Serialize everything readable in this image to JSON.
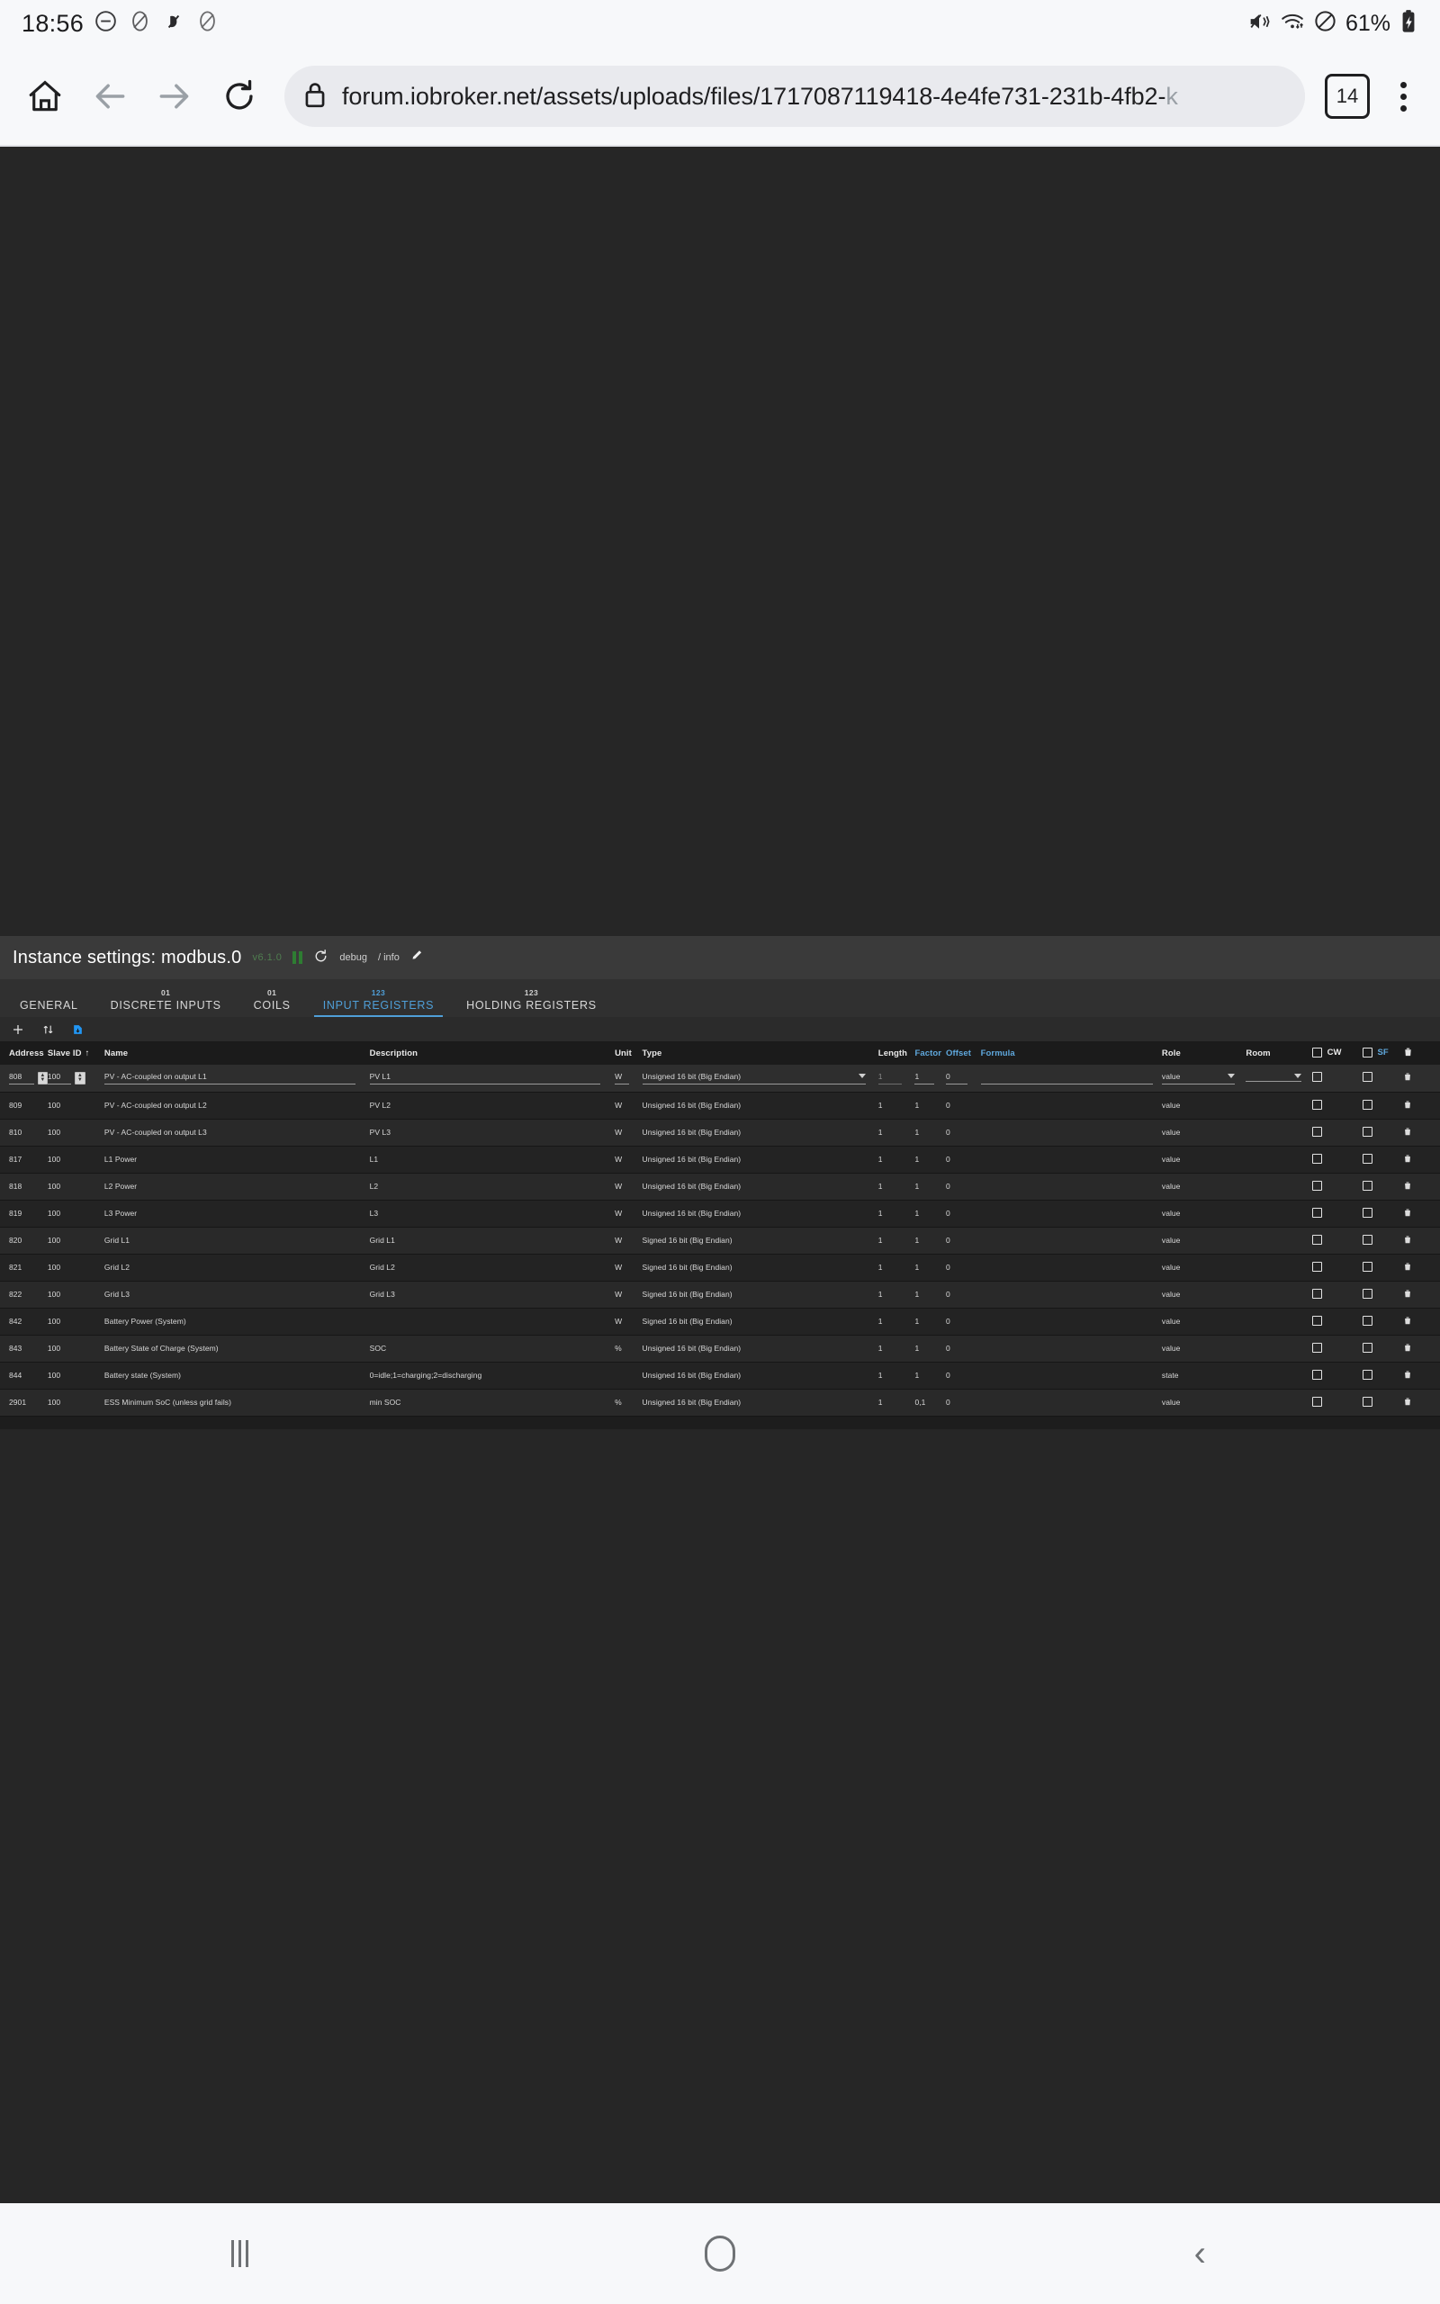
{
  "status_bar": {
    "clock": "18:56",
    "icons_left": [
      "do-not-disturb-icon",
      "no-notification-icon",
      "vibrate-off-icon",
      "no-notification-icon-2"
    ],
    "icons_right": [
      "mute-vibrate-icon",
      "wifi-icon",
      "block-icon"
    ],
    "battery_percent": "61%",
    "battery_icon": "battery-charging-icon"
  },
  "browser": {
    "home_icon": "home-icon",
    "back_icon": "back-arrow-icon",
    "forward_icon": "forward-arrow-icon",
    "reload_icon": "reload-icon",
    "lock_icon": "lock-icon",
    "url_visible": "forum.iobroker.net/assets/uploads/files/1717087119418-4e4fe731-231b-4fb2-",
    "url_faded": "k",
    "tab_count": "14",
    "menu_icon": "kebab-menu-icon"
  },
  "app": {
    "title": "Instance settings: modbus.0",
    "version": "v6.1.0",
    "pause_icon": "pause-icon",
    "refresh_icon": "refresh-icon",
    "log_level": "debug",
    "log_level_sep": "/ info",
    "edit_icon": "pencil-icon",
    "tabs": [
      {
        "badge": "",
        "label": "GENERAL",
        "active": false
      },
      {
        "badge": "01",
        "label": "DISCRETE INPUTS",
        "active": false
      },
      {
        "badge": "01",
        "label": "COILS",
        "active": false
      },
      {
        "badge": "123",
        "label": "INPUT REGISTERS",
        "active": true
      },
      {
        "badge": "123",
        "label": "HOLDING REGISTERS",
        "active": false
      }
    ],
    "toolbar": {
      "add_icon": "plus-icon",
      "sort_icon": "sort-updown-icon",
      "import_icon": "import-export-icon"
    },
    "table": {
      "columns": [
        {
          "key": "address",
          "label": "Address",
          "blue": false
        },
        {
          "key": "slave",
          "label": "Slave ID",
          "blue": false,
          "sort": "↑"
        },
        {
          "key": "name",
          "label": "Name",
          "blue": false
        },
        {
          "key": "desc",
          "label": "Description",
          "blue": false
        },
        {
          "key": "unit",
          "label": "Unit",
          "blue": false
        },
        {
          "key": "type",
          "label": "Type",
          "blue": false
        },
        {
          "key": "length",
          "label": "Length",
          "blue": false
        },
        {
          "key": "factor",
          "label": "Factor",
          "blue": true
        },
        {
          "key": "offset",
          "label": "Offset",
          "blue": true
        },
        {
          "key": "formula",
          "label": "Formula",
          "blue": true
        },
        {
          "key": "role",
          "label": "Role",
          "blue": false
        },
        {
          "key": "room",
          "label": "Room",
          "blue": false
        },
        {
          "key": "cw",
          "label": "CW",
          "blue": false
        },
        {
          "key": "sf",
          "label": "SF",
          "blue": true
        },
        {
          "key": "delete",
          "label": "",
          "blue": false
        }
      ],
      "rows": [
        {
          "address": "808",
          "slave": "100",
          "name": "PV - AC-coupled on output L1",
          "desc": "PV L1",
          "unit": "W",
          "type": "Unsigned 16 bit (Big Endian)",
          "length": "1",
          "factor": "1",
          "offset": "0",
          "formula": "",
          "role": "value",
          "room": ""
        },
        {
          "address": "809",
          "slave": "100",
          "name": "PV - AC-coupled on output L2",
          "desc": "PV L2",
          "unit": "W",
          "type": "Unsigned 16 bit (Big Endian)",
          "length": "1",
          "factor": "1",
          "offset": "0",
          "formula": "",
          "role": "value",
          "room": ""
        },
        {
          "address": "810",
          "slave": "100",
          "name": "PV - AC-coupled on output L3",
          "desc": "PV L3",
          "unit": "W",
          "type": "Unsigned 16 bit (Big Endian)",
          "length": "1",
          "factor": "1",
          "offset": "0",
          "formula": "",
          "role": "value",
          "room": ""
        },
        {
          "address": "817",
          "slave": "100",
          "name": "L1 Power",
          "desc": "L1",
          "unit": "W",
          "type": "Unsigned 16 bit (Big Endian)",
          "length": "1",
          "factor": "1",
          "offset": "0",
          "formula": "",
          "role": "value",
          "room": ""
        },
        {
          "address": "818",
          "slave": "100",
          "name": "L2 Power",
          "desc": "L2",
          "unit": "W",
          "type": "Unsigned 16 bit (Big Endian)",
          "length": "1",
          "factor": "1",
          "offset": "0",
          "formula": "",
          "role": "value",
          "room": ""
        },
        {
          "address": "819",
          "slave": "100",
          "name": "L3 Power",
          "desc": "L3",
          "unit": "W",
          "type": "Unsigned 16 bit (Big Endian)",
          "length": "1",
          "factor": "1",
          "offset": "0",
          "formula": "",
          "role": "value",
          "room": ""
        },
        {
          "address": "820",
          "slave": "100",
          "name": "Grid L1",
          "desc": "Grid L1",
          "unit": "W",
          "type": "Signed 16 bit (Big Endian)",
          "length": "1",
          "factor": "1",
          "offset": "0",
          "formula": "",
          "role": "value",
          "room": ""
        },
        {
          "address": "821",
          "slave": "100",
          "name": "Grid L2",
          "desc": "Grid L2",
          "unit": "W",
          "type": "Signed 16 bit (Big Endian)",
          "length": "1",
          "factor": "1",
          "offset": "0",
          "formula": "",
          "role": "value",
          "room": ""
        },
        {
          "address": "822",
          "slave": "100",
          "name": "Grid L3",
          "desc": "Grid L3",
          "unit": "W",
          "type": "Signed 16 bit (Big Endian)",
          "length": "1",
          "factor": "1",
          "offset": "0",
          "formula": "",
          "role": "value",
          "room": ""
        },
        {
          "address": "842",
          "slave": "100",
          "name": "Battery Power (System)",
          "desc": "",
          "unit": "W",
          "type": "Signed 16 bit (Big Endian)",
          "length": "1",
          "factor": "1",
          "offset": "0",
          "formula": "",
          "role": "value",
          "room": ""
        },
        {
          "address": "843",
          "slave": "100",
          "name": "Battery State of Charge (System)",
          "desc": "SOC",
          "unit": "%",
          "type": "Unsigned 16 bit (Big Endian)",
          "length": "1",
          "factor": "1",
          "offset": "0",
          "formula": "",
          "role": "value",
          "room": ""
        },
        {
          "address": "844",
          "slave": "100",
          "name": "Battery state (System)",
          "desc": "0=idle;1=charging;2=discharging",
          "unit": "",
          "type": "Unsigned 16 bit (Big Endian)",
          "length": "1",
          "factor": "1",
          "offset": "0",
          "formula": "",
          "role": "state",
          "room": ""
        },
        {
          "address": "2901",
          "slave": "100",
          "name": "ESS Minimum SoC (unless grid fails)",
          "desc": "min SOC",
          "unit": "%",
          "type": "Unsigned 16 bit (Big Endian)",
          "length": "1",
          "factor": "0,1",
          "offset": "0",
          "formula": "",
          "role": "value",
          "room": ""
        }
      ]
    },
    "colors": {
      "accent_blue": "#4f9fd8",
      "version_green": "#4f7d4f",
      "panel_bg": "#222222",
      "header_bg": "#3a3a3a"
    }
  },
  "nav_bar": {
    "recents_icon": "recents-icon",
    "home_icon": "home-pill-icon",
    "back_icon": "back-chevron-icon"
  }
}
